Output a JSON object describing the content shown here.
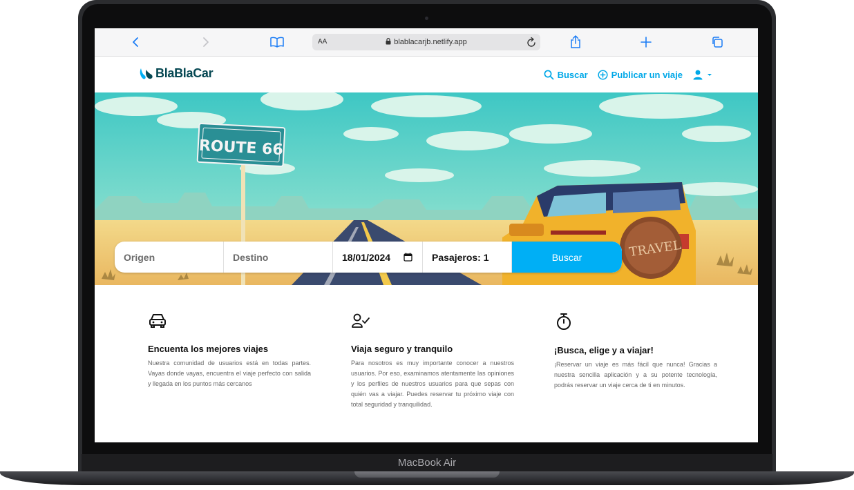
{
  "device": {
    "label": "MacBook Air"
  },
  "browser": {
    "reader_label": "AA",
    "url": "blablacarjb.netlify.app"
  },
  "site": {
    "logo_text": "BlaBlaCar",
    "nav": {
      "search": "Buscar",
      "publish": "Publicar un viaje"
    },
    "colors": {
      "brand": "#00aff5",
      "logo": "#054752"
    }
  },
  "hero": {
    "sign_text": "ROUTE 66",
    "tire_text": "TRAVEL",
    "search": {
      "origin_placeholder": "Origen",
      "destination_placeholder": "Destino",
      "date": "18/01/2024",
      "passengers": "Pasajeros: 1",
      "button": "Buscar"
    }
  },
  "features": [
    {
      "icon": "car-icon",
      "title": "Encuenta los mejores viajes",
      "text": "Nuestra comunidad de usuarios está en todas partes. Vayas donde vayas, encuentra el viaje perfecto con salida y llegada en los puntos más cercanos"
    },
    {
      "icon": "user-check-icon",
      "title": "Viaja seguro y tranquilo",
      "text": "Para nosotros es muy importante conocer a nuestros usuarios. Por eso, examinamos atentamente las opiniones y los perfiles de nuestros usuarios para que sepas con quién vas a viajar. Puedes reservar tu próximo viaje con total seguridad y tranquilidad."
    },
    {
      "icon": "stopwatch-icon",
      "title": "¡Busca, elige y a viajar!",
      "text": "¡Reservar un viaje es más fácil que nunca! Gracias a nuestra sencilla aplicación y a su potente tecnología, podrás reservar un viaje cerca de ti en minutos."
    }
  ]
}
